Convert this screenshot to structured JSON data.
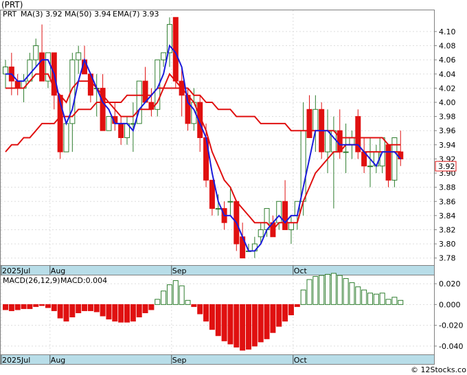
{
  "ticker_label": "(PRT)",
  "legend": {
    "ticker": "PRT",
    "items": [
      {
        "label": "MA(3)",
        "value": "3.92",
        "color": "#1a1adb"
      },
      {
        "label": "MA(50)",
        "value": "3.94",
        "color": "#1a1adb"
      },
      {
        "label": "EMA(7)",
        "value": "3.93",
        "color": "#1a1adb"
      }
    ]
  },
  "last_price_label": "3.92",
  "macd_label": "MACD(26,12,9)",
  "macd_value_label": "MACD:0.004",
  "watermark": "© 12Stocks.com",
  "colors": {
    "up": "#2e7d2e",
    "down": "#e01010",
    "ma": "#1a1adb",
    "ema": "#e01010",
    "axis_band": "#b8dde8",
    "price_tag": "#e01010"
  },
  "chart_data": {
    "type": "candlestick",
    "price_axis": {
      "min": 3.77,
      "max": 4.13,
      "ticks": [
        "4.10",
        "4.08",
        "4.06",
        "4.04",
        "4.02",
        "4.00",
        "3.98",
        "3.96",
        "3.94",
        "3.92",
        "3.90",
        "3.88",
        "3.86",
        "3.84",
        "3.82",
        "3.80",
        "3.78"
      ]
    },
    "macd_axis": {
      "min": -0.048,
      "max": 0.028,
      "ticks": [
        "0.020",
        "0.000",
        "-0.020",
        "-0.040"
      ]
    },
    "x_labels": [
      {
        "label": "2025Jul",
        "index": 0
      },
      {
        "label": "Aug",
        "index": 8
      },
      {
        "label": "Sep",
        "index": 28
      },
      {
        "label": "Oct",
        "index": 48
      }
    ],
    "candles": [
      [
        4.04,
        4.06,
        4.02,
        4.05
      ],
      [
        4.05,
        4.07,
        4.01,
        4.03
      ],
      [
        4.03,
        4.04,
        4.01,
        4.02
      ],
      [
        4.02,
        4.04,
        4.0,
        4.03
      ],
      [
        4.03,
        4.07,
        4.03,
        4.06
      ],
      [
        4.06,
        4.09,
        4.05,
        4.08
      ],
      [
        4.07,
        4.11,
        4.03,
        4.03
      ],
      [
        4.03,
        4.07,
        4.02,
        4.07
      ],
      [
        4.07,
        4.07,
        3.99,
        4.01
      ],
      [
        4.01,
        3.99,
        3.92,
        3.93
      ],
      [
        3.93,
        3.97,
        3.93,
        3.97
      ],
      [
        3.97,
        4.07,
        3.93,
        4.06
      ],
      [
        4.06,
        4.08,
        4.04,
        4.07
      ],
      [
        4.06,
        4.08,
        4.04,
        4.04
      ],
      [
        4.04,
        4.04,
        4.0,
        4.01
      ],
      [
        4.02,
        4.04,
        3.98,
        4.02
      ],
      [
        4.02,
        4.04,
        3.96,
        3.96
      ],
      [
        3.96,
        3.98,
        3.96,
        3.98
      ],
      [
        3.98,
        4.0,
        3.96,
        3.97
      ],
      [
        3.97,
        3.98,
        3.94,
        3.95
      ],
      [
        3.95,
        3.98,
        3.94,
        3.97
      ],
      [
        3.97,
        4.0,
        3.93,
        3.97
      ],
      [
        3.97,
        4.03,
        3.97,
        4.03
      ],
      [
        4.03,
        4.05,
        4.0,
        4.0
      ],
      [
        4.0,
        4.02,
        3.98,
        3.99
      ],
      [
        3.99,
        4.06,
        3.98,
        4.06
      ],
      [
        4.06,
        4.07,
        4.05,
        4.07
      ],
      [
        4.07,
        4.12,
        4.05,
        4.11
      ],
      [
        4.12,
        4.12,
        4.02,
        4.03
      ],
      [
        4.03,
        4.05,
        3.98,
        4.01
      ],
      [
        4.01,
        4.02,
        3.96,
        3.97
      ],
      [
        3.97,
        4.02,
        3.96,
        4.0
      ],
      [
        4.0,
        4.01,
        3.93,
        3.95
      ],
      [
        3.95,
        3.97,
        3.88,
        3.89
      ],
      [
        3.89,
        3.88,
        3.84,
        3.85
      ],
      [
        3.85,
        3.87,
        3.84,
        3.85
      ],
      [
        3.85,
        3.86,
        3.82,
        3.83
      ],
      [
        3.86,
        3.88,
        3.84,
        3.86
      ],
      [
        3.86,
        3.86,
        3.79,
        3.8
      ],
      [
        3.81,
        3.83,
        3.78,
        3.78
      ],
      [
        3.79,
        3.8,
        3.79,
        3.79
      ],
      [
        3.79,
        3.81,
        3.78,
        3.8
      ],
      [
        3.81,
        3.83,
        3.8,
        3.82
      ],
      [
        3.82,
        3.85,
        3.81,
        3.85
      ],
      [
        3.83,
        3.84,
        3.81,
        3.81
      ],
      [
        3.83,
        3.86,
        3.82,
        3.86
      ],
      [
        3.86,
        3.89,
        3.82,
        3.82
      ],
      [
        3.82,
        3.84,
        3.8,
        3.83
      ],
      [
        3.84,
        3.86,
        3.82,
        3.86
      ],
      [
        3.86,
        4.0,
        3.84,
        3.96
      ],
      [
        3.99,
        4.01,
        3.95,
        3.95
      ],
      [
        3.96,
        4.01,
        3.93,
        3.99
      ],
      [
        3.99,
        4.0,
        3.92,
        3.93
      ],
      [
        3.93,
        3.99,
        3.9,
        3.96
      ],
      [
        3.93,
        3.98,
        3.85,
        3.96
      ],
      [
        3.96,
        3.99,
        3.92,
        3.93
      ],
      [
        3.93,
        3.97,
        3.9,
        3.93
      ],
      [
        3.94,
        3.96,
        3.92,
        3.95
      ],
      [
        3.98,
        3.99,
        3.92,
        3.93
      ],
      [
        3.93,
        3.95,
        3.9,
        3.91
      ],
      [
        3.91,
        3.95,
        3.88,
        3.91
      ],
      [
        3.91,
        3.94,
        3.9,
        3.93
      ],
      [
        3.91,
        3.95,
        3.9,
        3.95
      ],
      [
        3.94,
        3.94,
        3.88,
        3.89
      ],
      [
        3.89,
        3.95,
        3.88,
        3.95
      ],
      [
        3.93,
        3.96,
        3.91,
        3.92
      ]
    ],
    "ma3": [
      4.04,
      4.04,
      4.03,
      4.03,
      4.04,
      4.05,
      4.06,
      4.06,
      4.04,
      4.0,
      3.97,
      3.99,
      4.03,
      4.06,
      4.04,
      4.02,
      4.0,
      3.99,
      3.97,
      3.97,
      3.97,
      3.96,
      3.99,
      4.0,
      4.01,
      4.02,
      4.04,
      4.08,
      4.07,
      4.05,
      4.0,
      3.99,
      3.97,
      3.95,
      3.9,
      3.86,
      3.84,
      3.84,
      3.83,
      3.81,
      3.79,
      3.79,
      3.8,
      3.82,
      3.83,
      3.84,
      3.83,
      3.84,
      3.84,
      3.88,
      3.92,
      3.96,
      3.96,
      3.96,
      3.95,
      3.94,
      3.94,
      3.94,
      3.94,
      3.93,
      3.92,
      3.91,
      3.93,
      3.93,
      3.93,
      3.92
    ],
    "ma50": [
      3.93,
      3.94,
      3.94,
      3.95,
      3.95,
      3.96,
      3.97,
      3.97,
      3.97,
      3.98,
      3.98,
      3.98,
      3.99,
      3.99,
      3.99,
      4.0,
      4.0,
      4.0,
      4.0,
      4.0,
      4.01,
      4.01,
      4.01,
      4.01,
      4.01,
      4.02,
      4.02,
      4.02,
      4.02,
      4.02,
      4.02,
      4.01,
      4.01,
      4.0,
      4.0,
      3.99,
      3.99,
      3.99,
      3.98,
      3.98,
      3.98,
      3.98,
      3.97,
      3.97,
      3.97,
      3.97,
      3.97,
      3.96,
      3.96,
      3.96,
      3.96,
      3.96,
      3.96,
      3.96,
      3.96,
      3.95,
      3.95,
      3.95,
      3.95,
      3.95,
      3.95,
      3.95,
      3.95,
      3.94,
      3.94,
      3.94
    ],
    "ema7": [
      4.02,
      4.02,
      4.02,
      4.02,
      4.03,
      4.04,
      4.04,
      4.04,
      4.02,
      4.01,
      4.0,
      4.02,
      4.03,
      4.03,
      4.03,
      4.02,
      4.01,
      4.0,
      3.99,
      3.98,
      3.98,
      3.98,
      3.99,
      3.99,
      3.99,
      4.0,
      4.02,
      4.04,
      4.03,
      4.02,
      4.01,
      4.0,
      3.98,
      3.96,
      3.93,
      3.91,
      3.89,
      3.88,
      3.86,
      3.85,
      3.84,
      3.83,
      3.83,
      3.83,
      3.82,
      3.83,
      3.83,
      3.83,
      3.83,
      3.86,
      3.88,
      3.9,
      3.91,
      3.92,
      3.93,
      3.93,
      3.94,
      3.94,
      3.94,
      3.93,
      3.93,
      3.93,
      3.93,
      3.93,
      3.93,
      3.93
    ],
    "macd": [
      -0.005,
      -0.006,
      -0.005,
      -0.004,
      -0.004,
      -0.002,
      -0.001,
      -0.003,
      -0.006,
      -0.013,
      -0.016,
      -0.012,
      -0.008,
      -0.006,
      -0.006,
      -0.007,
      -0.011,
      -0.014,
      -0.016,
      -0.017,
      -0.017,
      -0.016,
      -0.012,
      -0.008,
      -0.005,
      0.005,
      0.013,
      0.019,
      0.023,
      0.018,
      0.004,
      -0.002,
      -0.009,
      -0.016,
      -0.024,
      -0.03,
      -0.035,
      -0.038,
      -0.041,
      -0.044,
      -0.043,
      -0.04,
      -0.036,
      -0.033,
      -0.027,
      -0.021,
      -0.016,
      -0.01,
      -0.002,
      0.014,
      0.024,
      0.027,
      0.028,
      0.029,
      0.03,
      0.028,
      0.025,
      0.021,
      0.017,
      0.014,
      0.011,
      0.01,
      0.011,
      0.005,
      0.007,
      0.004
    ]
  }
}
